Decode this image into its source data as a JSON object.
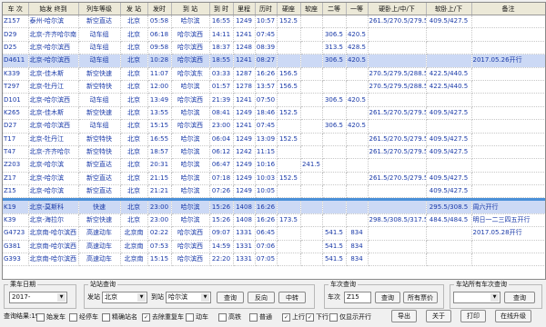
{
  "columns": [
    "车 次",
    "始发 终到",
    "列车等级",
    "发 站",
    "发时",
    "到 站",
    "到 时",
    "里程",
    "历时",
    "硬座",
    "软座",
    "二等",
    "一等",
    "硬卧上/中/下",
    "软卧上/下",
    "备注"
  ],
  "rows_top": [
    [
      "Z157",
      "泰州-哈尔滨",
      "新空直达",
      "北京",
      "05:58",
      "哈尔滨",
      "16:55",
      "1249",
      "10:57",
      "152.5",
      "",
      "",
      "",
      "261.5/270.5/279.5",
      "409.5/427.5",
      ""
    ],
    [
      "D29",
      "北京-齐齐哈尔南",
      "动车组",
      "北京",
      "06:18",
      "哈尔滨西",
      "14:11",
      "1241",
      "07:45",
      "",
      "",
      "306.5",
      "420.5",
      "",
      "",
      ""
    ],
    [
      "D25",
      "北京-哈尔滨西",
      "动车组",
      "北京",
      "09:58",
      "哈尔滨西",
      "18:37",
      "1248",
      "08:39",
      "",
      "",
      "313.5",
      "428.5",
      "",
      "",
      ""
    ],
    [
      "D4611",
      "北京-哈尔滨西",
      "动车组",
      "北京",
      "10:28",
      "哈尔滨西",
      "18:55",
      "1241",
      "08:27",
      "",
      "",
      "306.5",
      "420.5",
      "",
      "",
      "2017.05.26开行"
    ],
    [
      "K339",
      "北京-佳木斯",
      "新空快速",
      "北京",
      "11:07",
      "哈尔滨东",
      "03:33",
      "1287",
      "16:26",
      "156.5",
      "",
      "",
      "",
      "270.5/279.5/288.5",
      "422.5/440.5",
      ""
    ],
    [
      "T297",
      "北京-牡丹江",
      "新空特快",
      "北京",
      "12:00",
      "哈尔滨",
      "01:57",
      "1278",
      "13:57",
      "156.5",
      "",
      "",
      "",
      "270.5/279.5/288.5",
      "422.5/440.5",
      ""
    ],
    [
      "D101",
      "北京-哈尔滨西",
      "动车组",
      "北京",
      "13:49",
      "哈尔滨西",
      "21:39",
      "1241",
      "07:50",
      "",
      "",
      "306.5",
      "420.5",
      "",
      "",
      ""
    ],
    [
      "K265",
      "北京-佳木斯",
      "新空快速",
      "北京",
      "13:55",
      "哈尔滨",
      "08:41",
      "1249",
      "18:46",
      "152.5",
      "",
      "",
      "",
      "261.5/270.5/279.5",
      "409.5/427.5",
      ""
    ],
    [
      "D27",
      "北京-哈尔滨西",
      "动车组",
      "北京",
      "15:15",
      "哈尔滨西",
      "23:00",
      "1241",
      "07:45",
      "",
      "",
      "306.5",
      "420.5",
      "",
      "",
      ""
    ],
    [
      "T17",
      "北京-牡丹江",
      "新空特快",
      "北京",
      "16:55",
      "哈尔滨",
      "06:04",
      "1249",
      "13:09",
      "152.5",
      "",
      "",
      "",
      "261.5/270.5/279.5",
      "409.5/427.5",
      ""
    ],
    [
      "T47",
      "北京-齐齐哈尔",
      "新空特快",
      "北京",
      "18:57",
      "哈尔滨",
      "06:12",
      "1242",
      "11:15",
      "",
      "",
      "",
      "",
      "261.5/270.5/279.5",
      "409.5/427.5",
      ""
    ],
    [
      "Z203",
      "北京-哈尔滨",
      "新空直达",
      "北京",
      "20:31",
      "哈尔滨",
      "06:47",
      "1249",
      "10:16",
      "",
      "241.5",
      "",
      "",
      "",
      "",
      ""
    ],
    [
      "Z17",
      "北京-哈尔滨",
      "新空直达",
      "北京",
      "21:15",
      "哈尔滨",
      "07:18",
      "1249",
      "10:03",
      "152.5",
      "",
      "",
      "",
      "261.5/270.5/279.5",
      "409.5/427.5",
      ""
    ],
    [
      "Z15",
      "北京-哈尔滨",
      "新空直达",
      "北京",
      "21:21",
      "哈尔滨",
      "07:26",
      "1249",
      "10:05",
      "",
      "",
      "",
      "",
      "",
      "409.5/427.5",
      ""
    ]
  ],
  "rows_bottom": [
    [
      "K19",
      "北京-莫斯科",
      "快速",
      "北京",
      "23:00",
      "哈尔滨",
      "15:26",
      "1408",
      "16:26",
      "",
      "",
      "",
      "",
      "",
      "295.5/308.5",
      "周六开行"
    ],
    [
      "K39",
      "北京-海拉尔",
      "新空快速",
      "北京",
      "23:00",
      "哈尔滨",
      "15:26",
      "1408",
      "16:26",
      "173.5",
      "",
      "",
      "",
      "298.5/308.5/317.5",
      "484.5/484.5",
      "明日一二三四五开行"
    ],
    [
      "G4723",
      "北京南-哈尔滨西",
      "高速动车",
      "北京南",
      "02:22",
      "哈尔滨西",
      "09:07",
      "1331",
      "06:45",
      "",
      "",
      "541.5",
      "834",
      "",
      "",
      "2017.05.28开行"
    ],
    [
      "G381",
      "北京南-哈尔滨西",
      "高速动车",
      "北京南",
      "07:53",
      "哈尔滨西",
      "14:59",
      "1331",
      "07:06",
      "",
      "",
      "541.5",
      "834",
      "",
      "",
      ""
    ],
    [
      "G393",
      "北京南-哈尔滨西",
      "高速动车",
      "北京南",
      "15:15",
      "哈尔滨西",
      "22:20",
      "1331",
      "07:05",
      "",
      "",
      "541.5",
      "834",
      "",
      "",
      ""
    ]
  ],
  "selected_top_index": 3,
  "highlight_bottom_index": 0,
  "bottom": {
    "date_group": "乘车日期",
    "date_value": "2017-",
    "station_group": "站站查询",
    "from_label": "发站",
    "from_value": "北京",
    "to_label": "到站",
    "to_value": "哈尔滨",
    "query": "查询",
    "reverse": "反向",
    "transfer": "中转",
    "train_group": "车次查询",
    "train_label": "车次",
    "train_value": "Z15",
    "train_query": "查询",
    "all_prices": "所有票价",
    "station_all_group": "车站所有车次查询",
    "station_query": "查询",
    "result_label": "查询结果:19",
    "checks": [
      {
        "label": "始发车",
        "checked": false
      },
      {
        "label": "经停车",
        "checked": false
      },
      {
        "label": "精确站名",
        "checked": false
      },
      {
        "label": "去除重复车",
        "checked": true
      },
      {
        "label": "动车",
        "checked": false
      },
      {
        "label": "高铁",
        "checked": false
      },
      {
        "label": "普通",
        "checked": false
      },
      {
        "label": "上行",
        "checked": true
      },
      {
        "label": "下行",
        "checked": true
      },
      {
        "label": "仅显示开行",
        "checked": false
      }
    ],
    "export": "导出",
    "about": "关于",
    "print": "打印",
    "upgrade": "在线升级"
  }
}
